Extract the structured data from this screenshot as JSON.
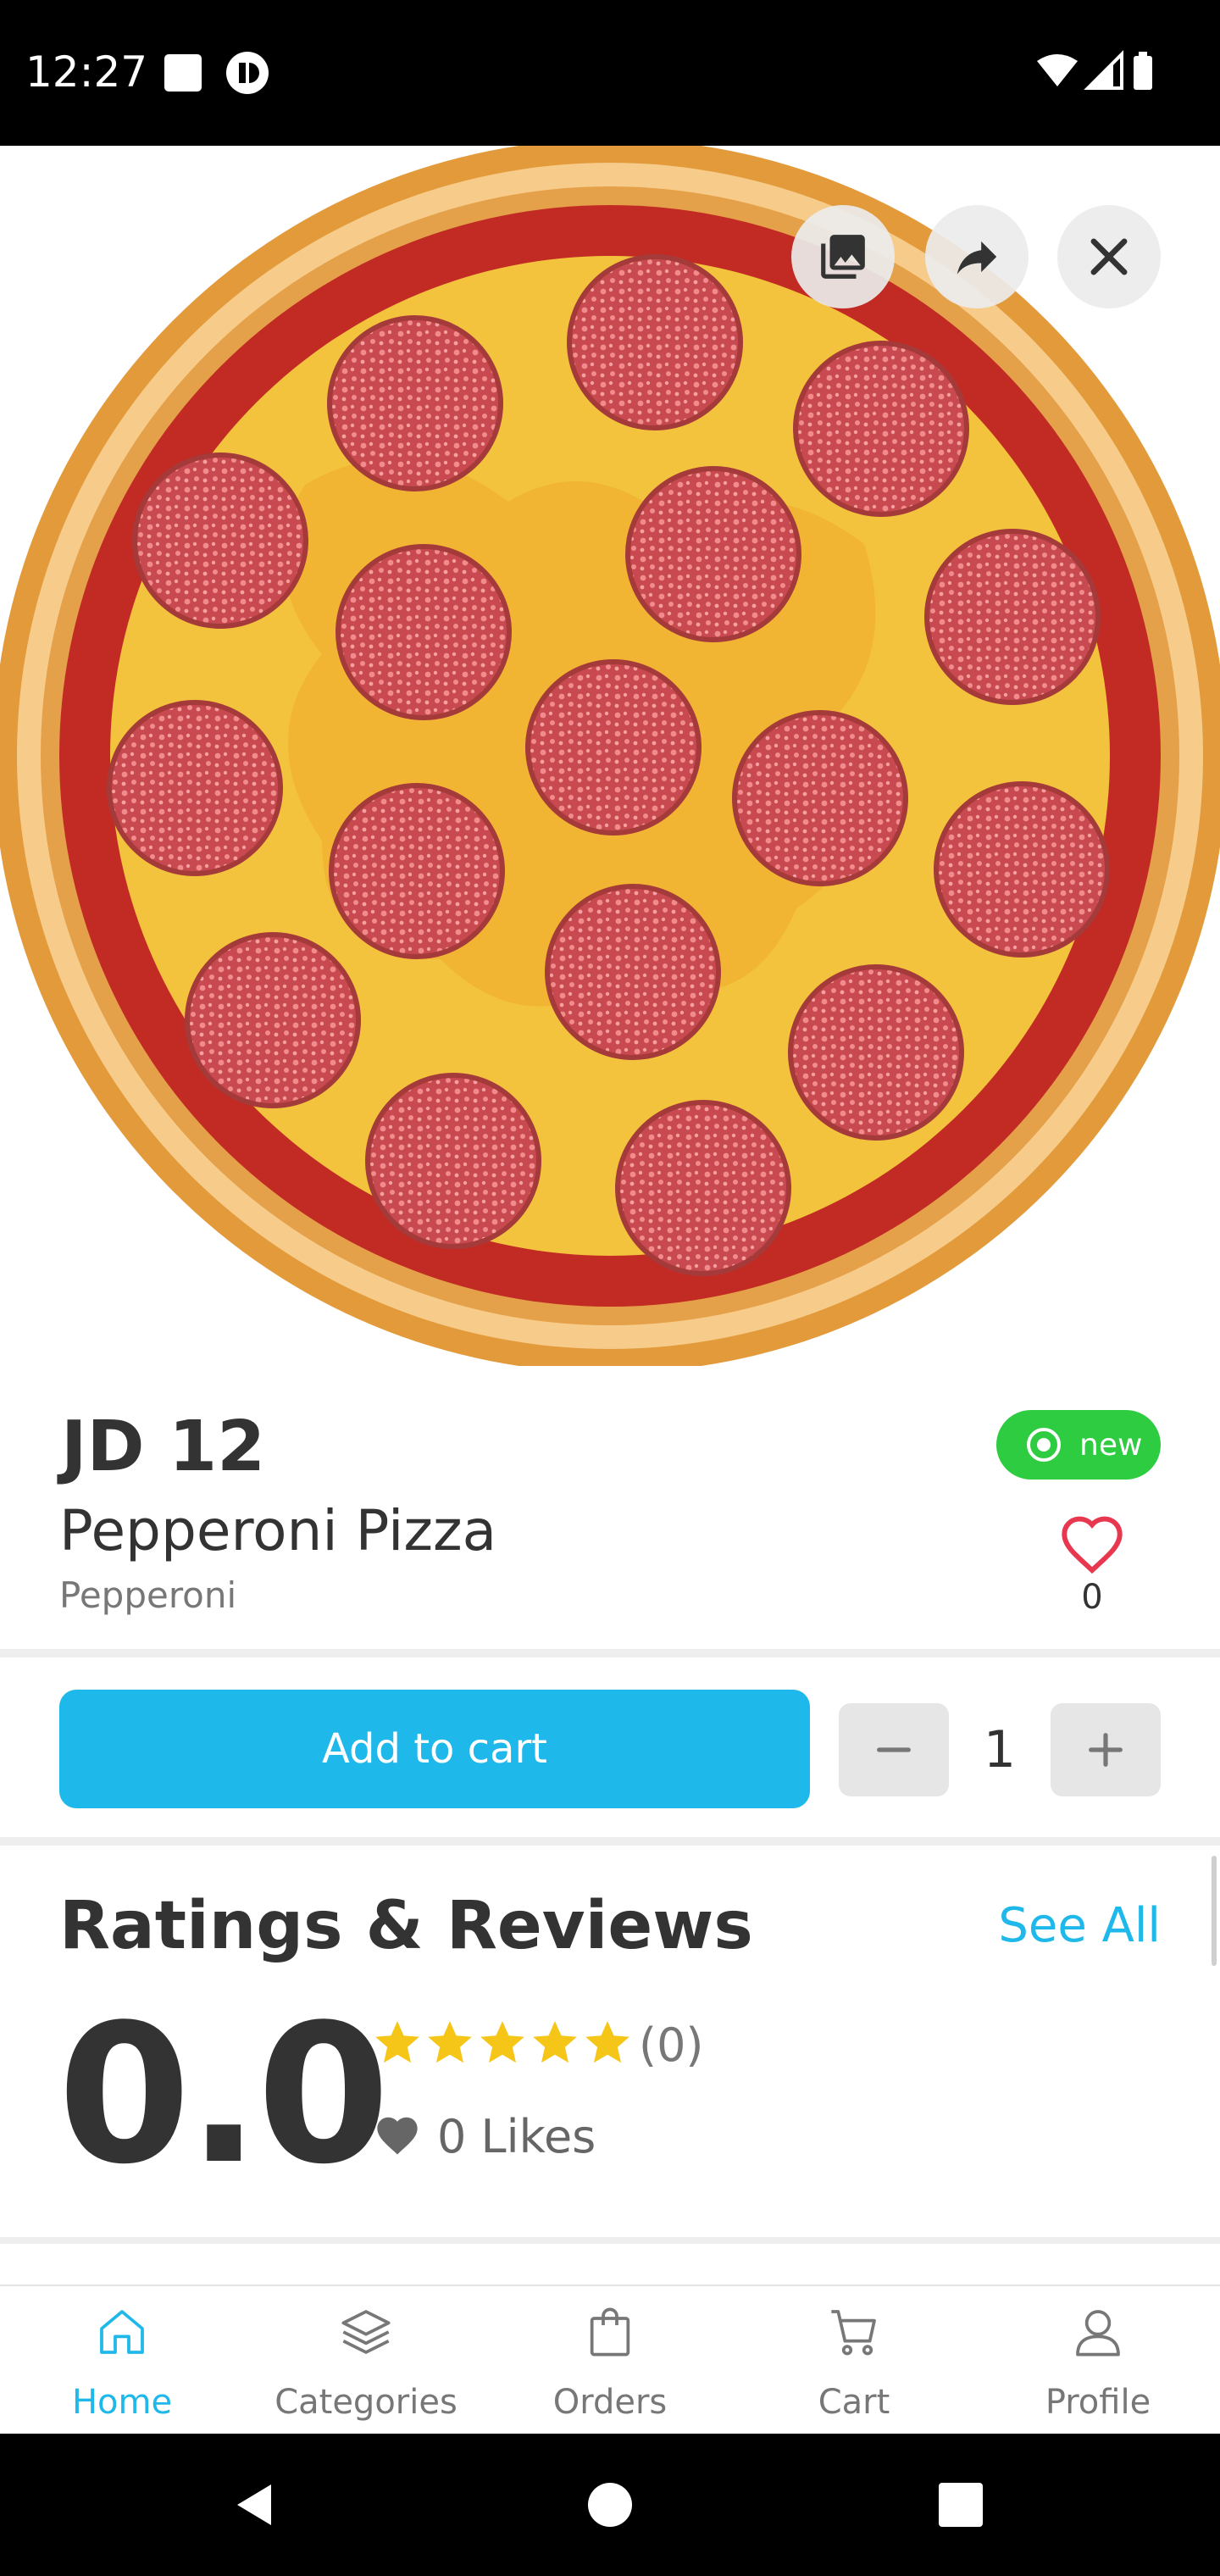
{
  "status_bar": {
    "time": "12:27"
  },
  "hero": {
    "gallery_icon": "gallery-icon",
    "share_icon": "share-icon",
    "close_icon": "close-icon"
  },
  "product": {
    "price": "JD 12",
    "name": "Pepperoni Pizza",
    "subname": "Pepperoni",
    "badge_label": "new",
    "likes_count": "0"
  },
  "cart": {
    "add_label": "Add to cart",
    "quantity": "1"
  },
  "ratings": {
    "title": "Ratings & Reviews",
    "see_all": "See All",
    "average": "0.0",
    "count": "(0)",
    "likes": "0 Likes",
    "stars": 5,
    "star_color": "#f5c518"
  },
  "nav": {
    "items": [
      {
        "label": "Home",
        "icon": "home-icon",
        "active": true
      },
      {
        "label": "Categories",
        "icon": "layers-icon",
        "active": false
      },
      {
        "label": "Orders",
        "icon": "bag-icon",
        "active": false
      },
      {
        "label": "Cart",
        "icon": "cart-icon",
        "active": false
      },
      {
        "label": "Profile",
        "icon": "user-icon",
        "active": false
      }
    ]
  },
  "colors": {
    "accent": "#1eb8ea",
    "badge": "#2ecc40",
    "heart": "#e8384f"
  }
}
